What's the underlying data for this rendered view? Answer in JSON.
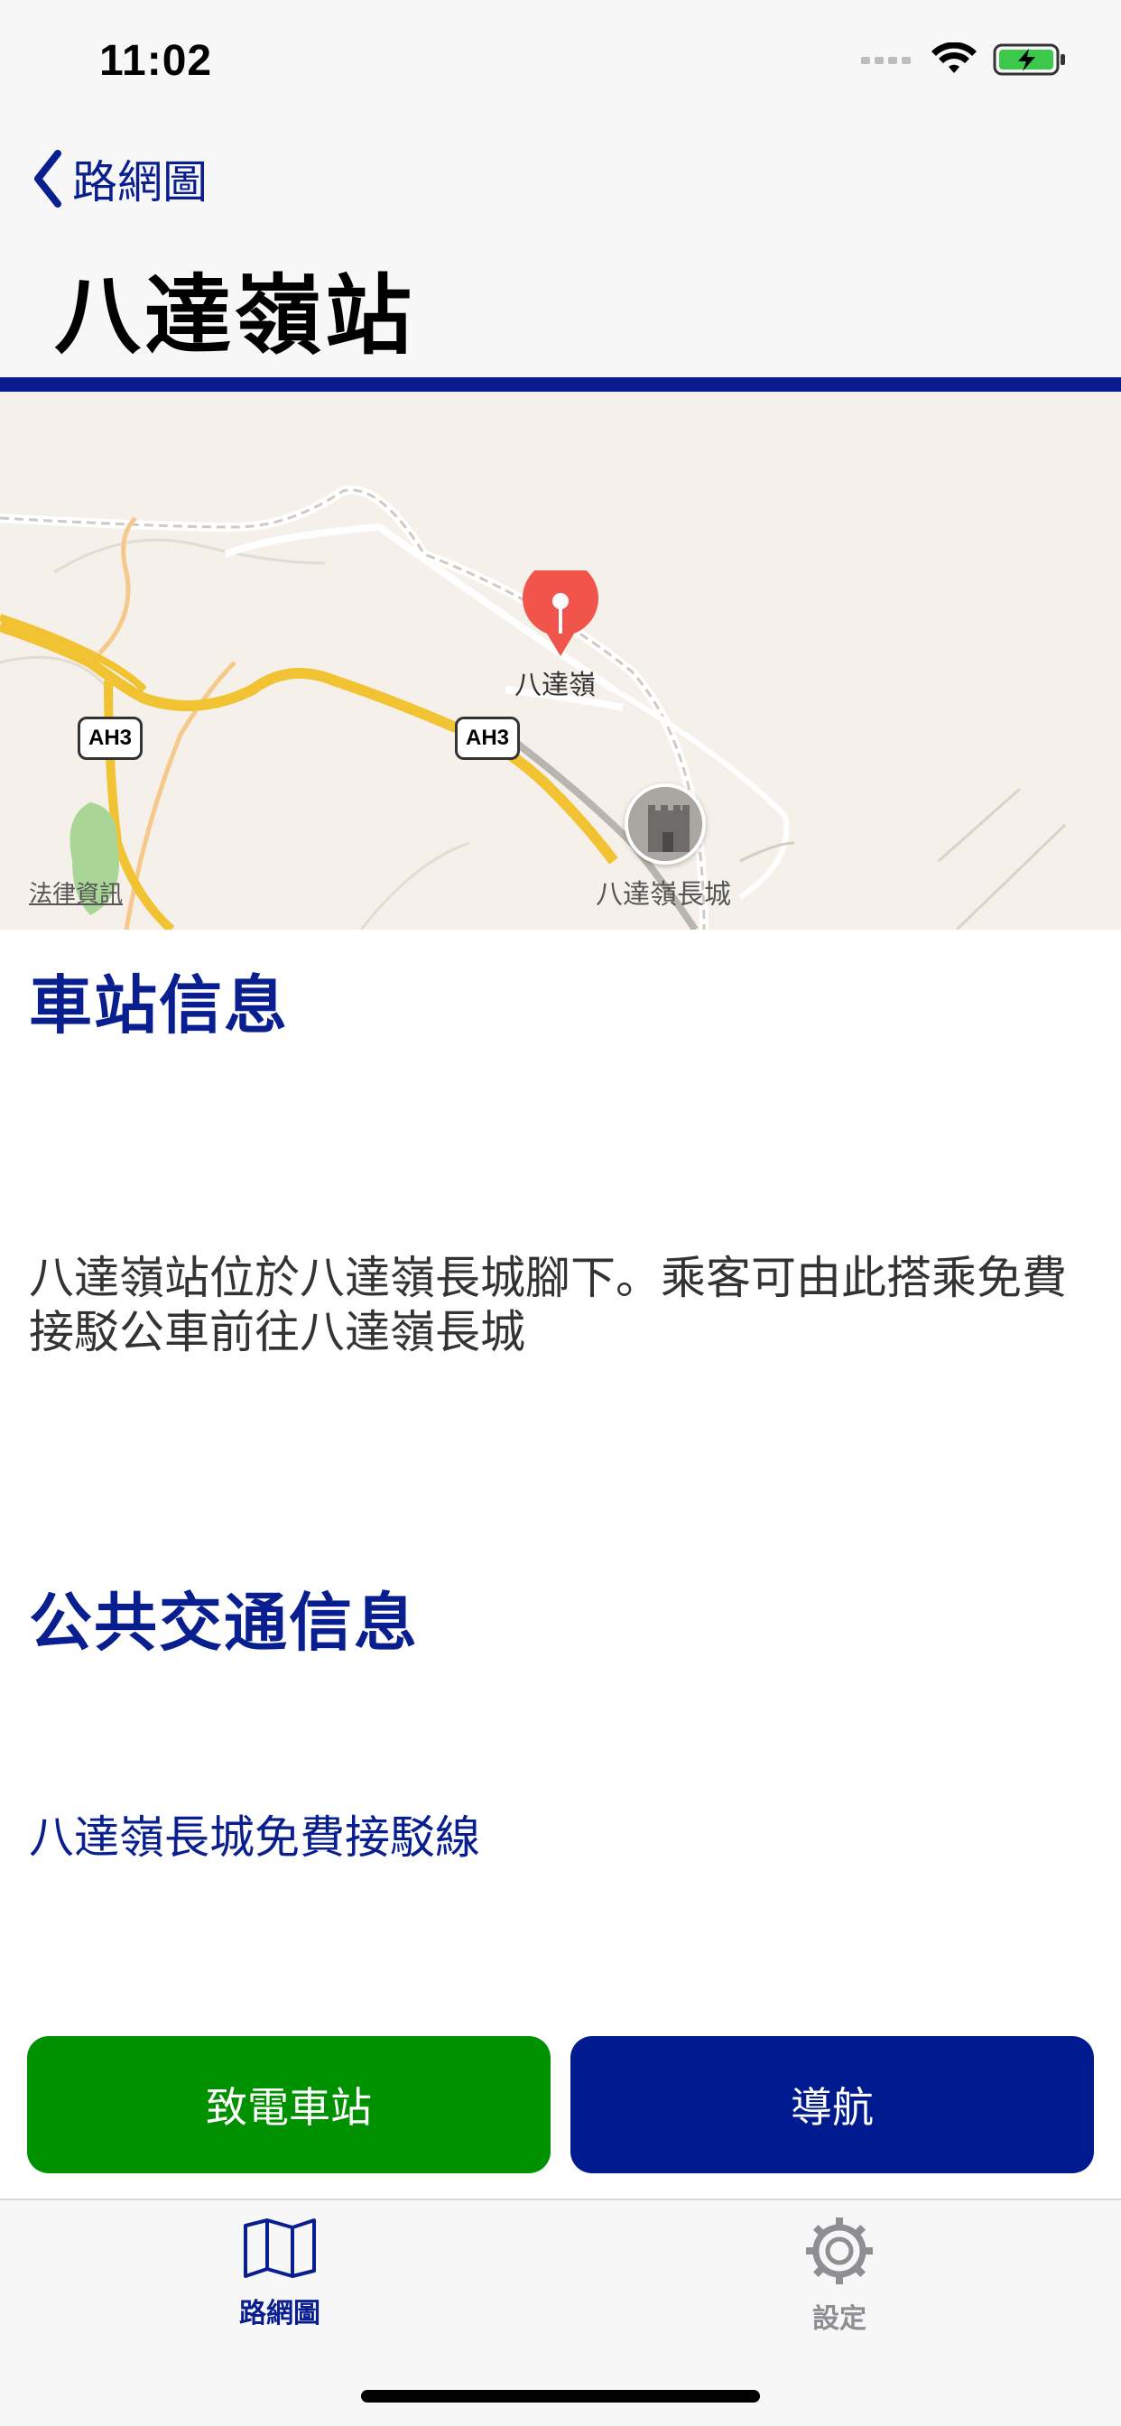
{
  "status_bar": {
    "time": "11:02"
  },
  "nav": {
    "back_label": "路網圖",
    "title": "八達嶺站"
  },
  "map": {
    "pin_label": "八達嶺",
    "landmark_label": "八達嶺長城",
    "route_shields": [
      "AH3",
      "AH3"
    ],
    "legal_label": "法律資訊"
  },
  "station_info": {
    "heading": "車站信息",
    "description": "八達嶺站位於八達嶺長城腳下。乘客可由此搭乘免費接駁公車前往八達嶺長城"
  },
  "transit_info": {
    "heading": "公共交通信息",
    "lines": [
      "八達嶺長城免費接駁線"
    ]
  },
  "actions": {
    "call_label": "致電車站",
    "navigate_label": "導航"
  },
  "tab_bar": {
    "tabs": [
      {
        "label": "路網圖",
        "icon": "map-icon",
        "selected": true
      },
      {
        "label": "設定",
        "icon": "gear-icon",
        "selected": false
      }
    ]
  },
  "colors": {
    "accent": "#0a1f8f",
    "call_button": "#009100",
    "navigate_button": "#001a8f",
    "pin": "#f0544a"
  }
}
